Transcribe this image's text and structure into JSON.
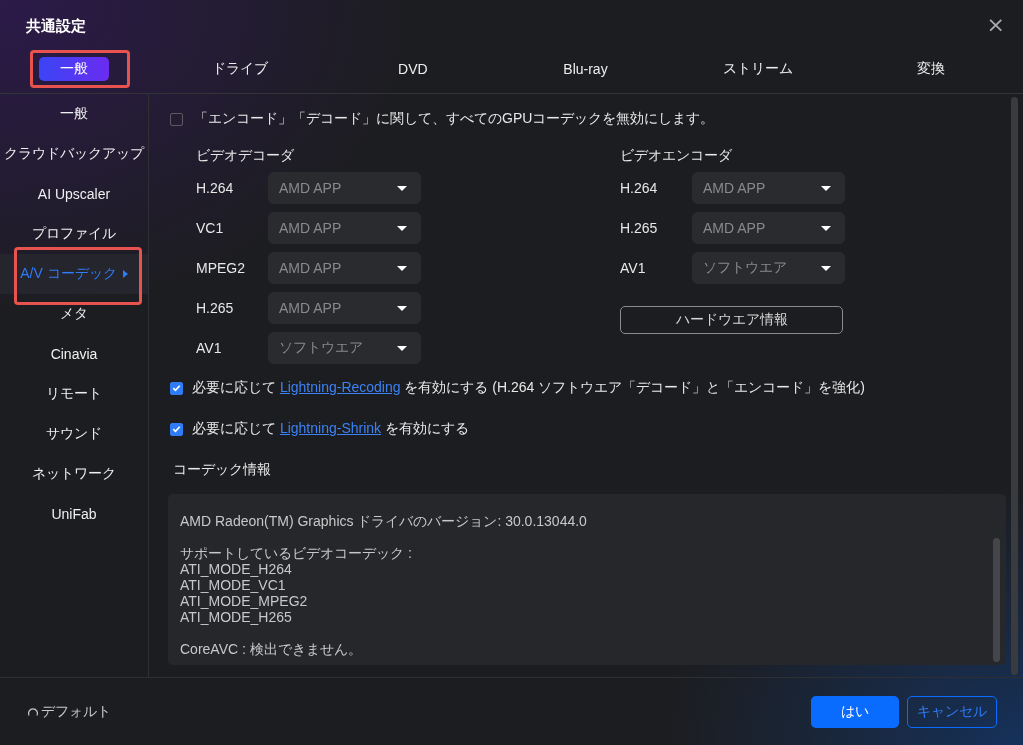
{
  "window": {
    "title": "共通設定",
    "close": "×"
  },
  "tabs": [
    {
      "label": "一般",
      "selected": true,
      "highlighted": true
    },
    {
      "label": "ドライブ",
      "selected": false,
      "highlighted": false
    },
    {
      "label": "DVD",
      "selected": false,
      "highlighted": false
    },
    {
      "label": "Blu-ray",
      "selected": false,
      "highlighted": false
    },
    {
      "label": "ストリーム",
      "selected": false,
      "highlighted": false
    },
    {
      "label": "変換",
      "selected": false,
      "highlighted": false
    }
  ],
  "sidebar": {
    "items": [
      {
        "label": "一般",
        "selected": false,
        "highlighted": false
      },
      {
        "label": "クラウドバックアップ",
        "selected": false,
        "highlighted": false
      },
      {
        "label": "AI Upscaler",
        "selected": false,
        "highlighted": false
      },
      {
        "label": "プロファイル",
        "selected": false,
        "highlighted": false
      },
      {
        "label": "A/V コーデック",
        "selected": true,
        "highlighted": true
      },
      {
        "label": "メタ",
        "selected": false,
        "highlighted": false
      },
      {
        "label": "Cinavia",
        "selected": false,
        "highlighted": false
      },
      {
        "label": "リモート",
        "selected": false,
        "highlighted": false
      },
      {
        "label": "サウンド",
        "selected": false,
        "highlighted": false
      },
      {
        "label": "ネットワーク",
        "selected": false,
        "highlighted": false
      },
      {
        "label": "UniFab",
        "selected": false,
        "highlighted": false
      }
    ]
  },
  "disable_gpu": {
    "label": "「エンコード」「デコード」に関して、すべてのGPUコーデックを無効にします。",
    "checked": false
  },
  "decoder": {
    "heading": "ビデオデコーダ",
    "rows": [
      {
        "label": "H.264",
        "value": "AMD APP"
      },
      {
        "label": "VC1",
        "value": "AMD APP"
      },
      {
        "label": "MPEG2",
        "value": "AMD APP"
      },
      {
        "label": "H.265",
        "value": "AMD APP"
      },
      {
        "label": "AV1",
        "value": "ソフトウエア"
      }
    ]
  },
  "encoder": {
    "heading": "ビデオエンコーダ",
    "rows": [
      {
        "label": "H.264",
        "value": "AMD APP"
      },
      {
        "label": "H.265",
        "value": "AMD APP"
      },
      {
        "label": "AV1",
        "value": "ソフトウエア"
      }
    ],
    "button": "ハードウエア情報"
  },
  "options": [
    {
      "before": "必要に応じて",
      "link": "Lightning-Recoding",
      "after": "を有効にする (H.264 ソフトウエア「デコード」と「エンコード」を強化)",
      "checked": true
    },
    {
      "before": "必要に応じて",
      "link": "Lightning-Shrink",
      "after": "を有効にする",
      "checked": true
    }
  ],
  "codec_info": {
    "heading": "コーデック情報",
    "paragraphs": [
      [
        "AMD Radeon(TM) Graphics ドライバのバージョン: 30.0.13044.0"
      ],
      [
        "サポートしているビデオコーデック :",
        "ATI_MODE_H264",
        "ATI_MODE_VC1",
        "ATI_MODE_MPEG2",
        "ATI_MODE_H265"
      ],
      [
        "CoreAVC : 検出できません。"
      ]
    ]
  },
  "footer": {
    "default": "デフォルト",
    "buttons": [
      {
        "label": "はい",
        "kind": "primary"
      },
      {
        "label": "キャンセル",
        "kind": "secondary"
      }
    ]
  }
}
